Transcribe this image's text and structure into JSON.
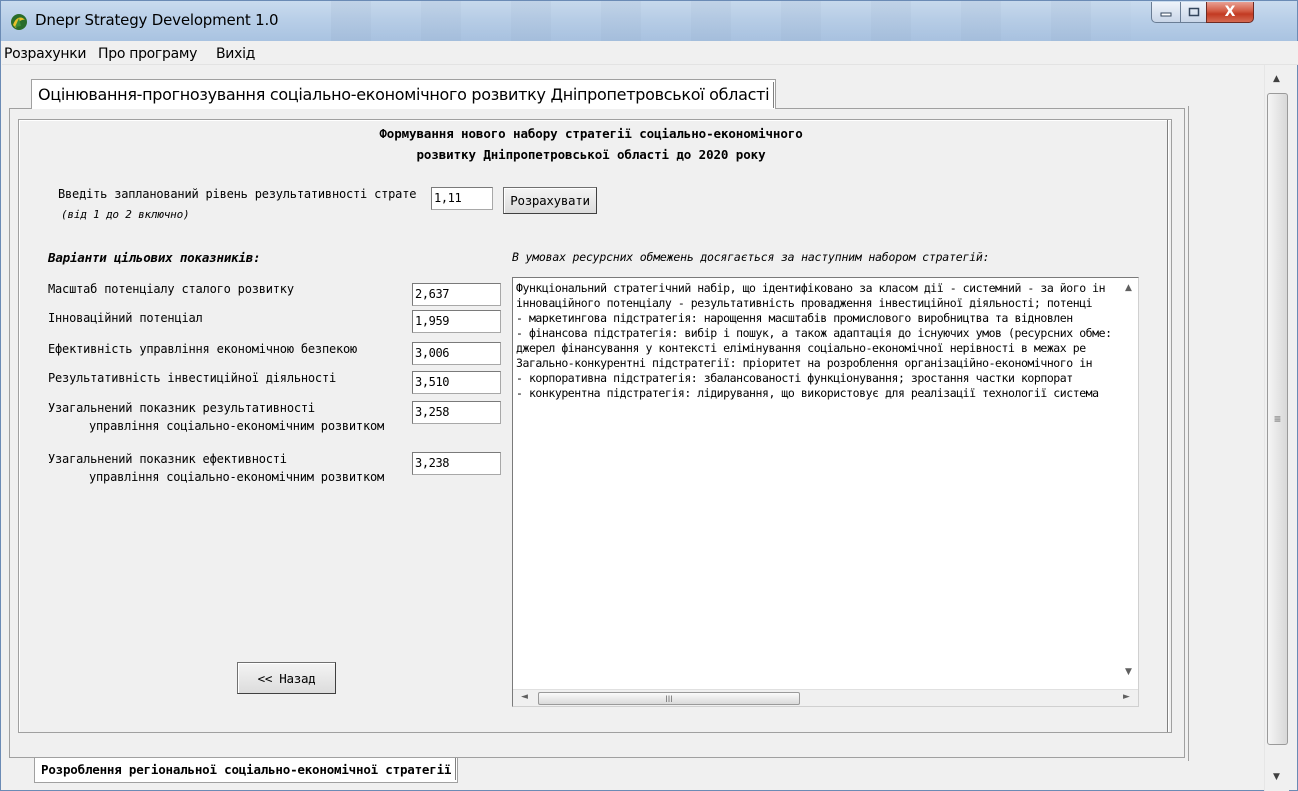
{
  "window": {
    "title": "Dnepr Strategy Development 1.0",
    "close_glyph": "X",
    "icon": "app-logo-icon"
  },
  "menu": {
    "items": [
      "Розрахунки",
      "Про програму",
      "Вихід"
    ]
  },
  "outer_tab": {
    "label": "Оцінювання-прогнозування соціально-економічного розвитку Дніпропетровської області"
  },
  "panel": {
    "heading_line1": "Формування нового набору стратегії соціально-економічного",
    "heading_line2": "розвитку Дніпропетровської області до 2020 року",
    "level_label": "Введіть запланований рівень результативності страте",
    "level_hint": "(від 1 до 2 включно)",
    "level_value": "1,11",
    "calculate_button": "Розрахувати",
    "variants_title": "Варіанти цільових показників:",
    "result_title": "В умовах ресурсних обмежень досягається за наступним набором стратегій:",
    "indicators": [
      {
        "label": "Масштаб потенціалу сталого розвитку",
        "value": "2,637"
      },
      {
        "label": "Інноваційний потенціал",
        "value": "1,959"
      },
      {
        "label": "Ефективність управління економічною безпекою",
        "value": "3,006"
      },
      {
        "label": "Результативність інвестиційної діяльності",
        "value": "3,510"
      },
      {
        "label": "Узагальнений показник результативності",
        "label2": "управління соціально-економічним розвитком",
        "value": "3,258"
      },
      {
        "label": "Узагальнений показник ефективності",
        "label2": "управління соціально-економічним розвитком",
        "value": "3,238"
      }
    ],
    "back_button": "<< Назад",
    "memo_lines": [
      "Функціональний стратегічний набір, що ідентифіковано за класом дії - системний - за його ін",
      "інноваційного потенціалу - результативність провадження інвестиційної діяльності; потенці",
      " - маркетингова підстратегія: нарощення масштабів промислового виробництва та відновлен",
      " - фінансова підстратегія: вибір і пошук, а також адаптація до існуючих умов (ресурсних обме:",
      "джерел фінансування у контексті елімінування соціально-економічної нерівності в межах ре",
      "Загально-конкурентні підстратегії: пріоритет на розроблення організаційно-економічного ін",
      " - корпоративна підстратегія: збалансованості функціонування; зростання частки корпорат",
      " - конкурентна підстратегія: лідирування, що використовує для реалізації технології система"
    ],
    "scroll_thumb_grip": "III"
  },
  "bottom_tab": {
    "label": "Розроблення регіональної соціально-економічної стратегії"
  },
  "scrollbar": {
    "grip": "≡"
  },
  "colors": {
    "titlebar": "#b9cfe8",
    "close_button": "#c23a22",
    "panel_bg": "#f0f0f0"
  }
}
